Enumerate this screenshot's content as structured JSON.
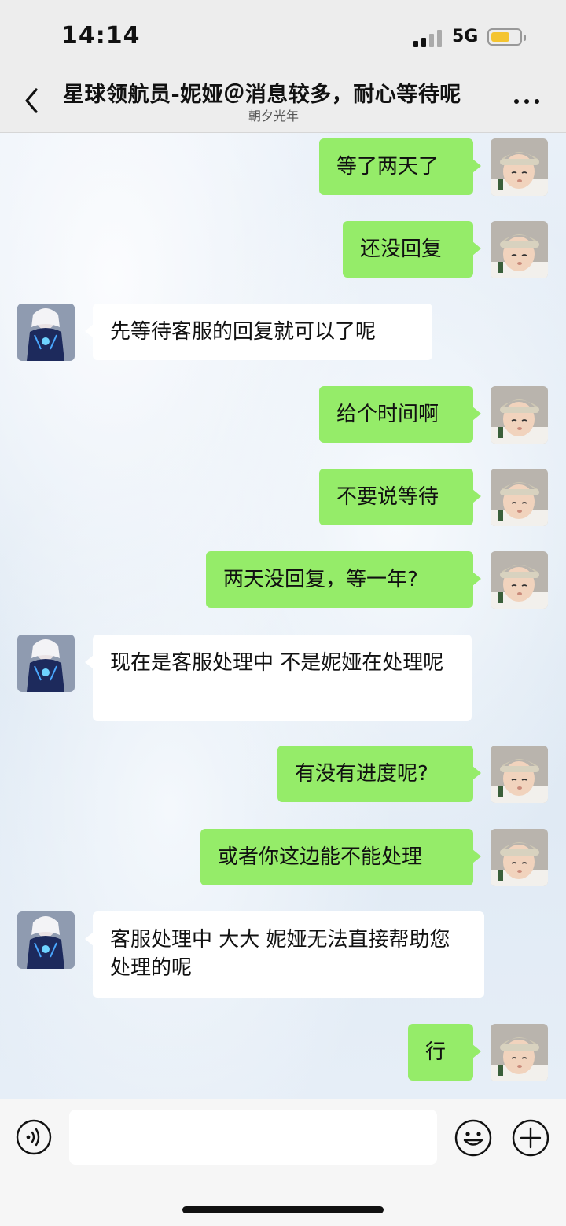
{
  "status_bar": {
    "time": "14:14",
    "network": "5G",
    "battery_level": 0.65
  },
  "header": {
    "title": "星球领航员-妮娅＠消息较多，耐心等待呢",
    "subtitle": "朝夕光年",
    "back_icon": "chevron-left-icon",
    "more_icon": "more-dots-icon"
  },
  "colors": {
    "my_bubble": "#95ec69",
    "their_bubble": "#ffffff",
    "accent_battery": "#f4c430"
  },
  "messages": [
    {
      "from": "me",
      "text": "等了两天了"
    },
    {
      "from": "me",
      "text": "还没回复"
    },
    {
      "from": "other",
      "text": "先等待客服的回复就可以了呢"
    },
    {
      "from": "me",
      "text": "给个时间啊"
    },
    {
      "from": "me",
      "text": "不要说等待"
    },
    {
      "from": "me",
      "text": "两天没回复，等一年?"
    },
    {
      "from": "other",
      "text": "现在是客服处理中  不是妮娅在处理呢"
    },
    {
      "from": "me",
      "text": "有没有进度呢?"
    },
    {
      "from": "me",
      "text": "或者你这边能不能处理"
    },
    {
      "from": "other",
      "text": "客服处理中 大大  妮娅无法直接帮助您处理的呢"
    },
    {
      "from": "me",
      "text": "行"
    }
  ],
  "input_bar": {
    "text_value": "",
    "voice_icon": "voice-icon",
    "emoji_icon": "emoji-icon",
    "plus_icon": "plus-icon"
  }
}
